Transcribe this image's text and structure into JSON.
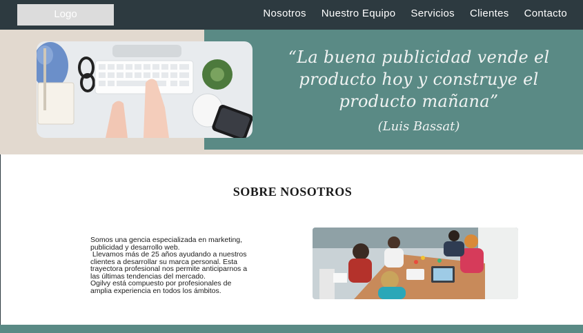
{
  "header": {
    "logo": "Logo",
    "nav": [
      "Nosotros",
      "Nuestro Equipo",
      "Servicios",
      "Clientes",
      "Contacto"
    ]
  },
  "hero": {
    "quote_lines": [
      "“La buena publicidad vende el",
      "producto hoy y construye el",
      "producto mañana”"
    ],
    "author": "(Luis Bassat)"
  },
  "about": {
    "title": "SOBRE NOSOTROS",
    "paragraphs": [
      "Somos una gencia especializada en marketing,",
      "publicidad y desarrollo web.",
      " Llevamos más de 25 años ayudando a nuestros",
      "clientes a desarrollar su marca personal. Esta",
      "trayectora profesional nos permite anticiparnos a",
      "las últimas tendencias del mercado.",
      "Ogilvy está compuesto por profesionales de",
      "amplia experiencia en todos los ámbitos."
    ]
  },
  "colors": {
    "topbar": "#2d3a40",
    "teal": "#5a8a85",
    "beige": "#e2d9cf"
  }
}
